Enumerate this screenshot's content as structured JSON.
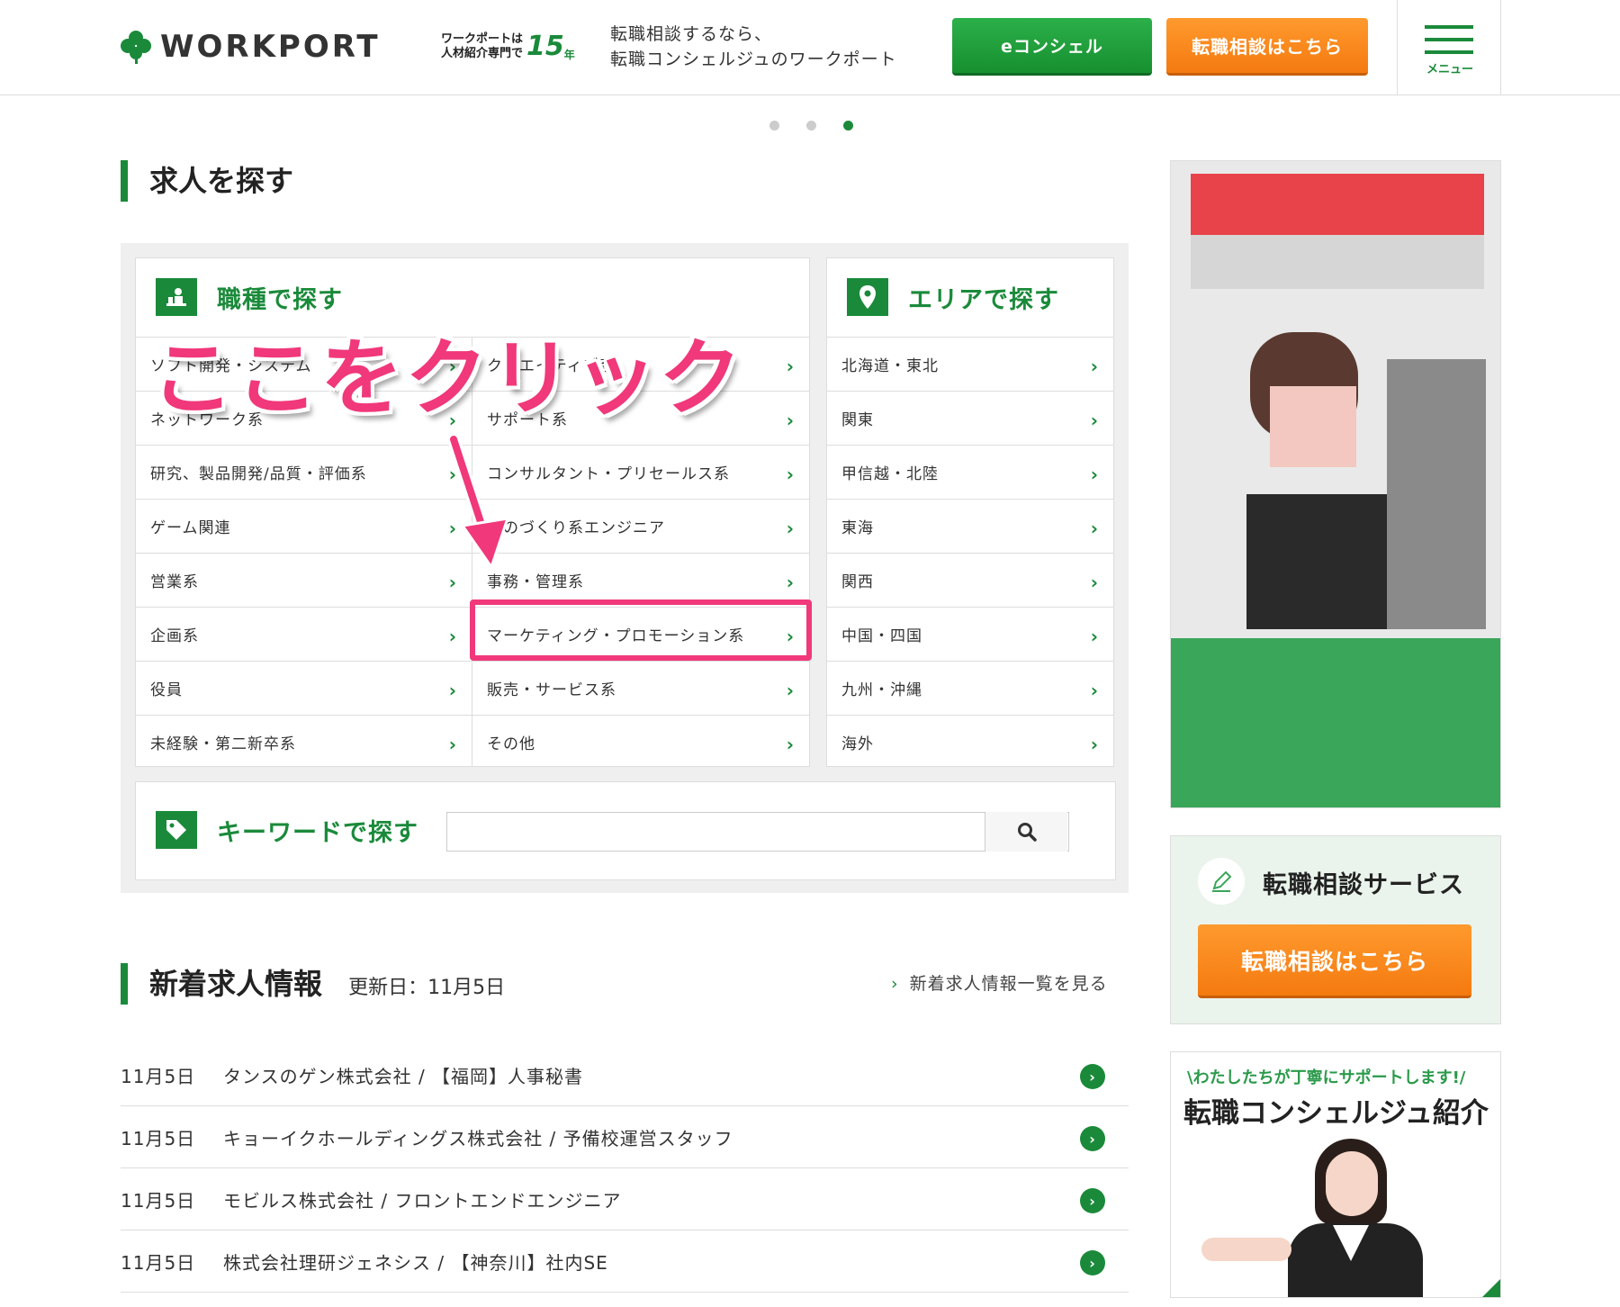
{
  "header": {
    "logo_text": "WORKPORT",
    "badge_line1": "ワークポートは",
    "badge_line2": "人材紹介専門で",
    "badge_number": "15",
    "badge_unit": "年",
    "tagline_line1": "転職相談するなら、",
    "tagline_line2": "転職コンシェルジュのワークポート",
    "econcier_label": "eコンシェル",
    "consult_label": "転職相談はこちら",
    "menu_label": "メニュー"
  },
  "carousel": {
    "active_index": 2,
    "count": 3
  },
  "search_section": {
    "title": "求人を探す",
    "job_card": {
      "title": "職種で探す",
      "left_items": [
        "ソフト開発・システム",
        "ネットワーク系",
        "研究、製品開発/品質・評価系",
        "ゲーム関連",
        "営業系",
        "企画系",
        "役員",
        "未経験・第二新卒系"
      ],
      "right_items": [
        "クリエイティブ系",
        "サポート系",
        "コンサルタント・プリセールス系",
        "ものづくり系エンジニア",
        "事務・管理系",
        "マーケティング・プロモーション系",
        "販売・サービス系",
        "その他"
      ]
    },
    "area_card": {
      "title": "エリアで探す",
      "items": [
        "北海道・東北",
        "関東",
        "甲信越・北陸",
        "東海",
        "関西",
        "中国・四国",
        "九州・沖縄",
        "海外"
      ]
    },
    "keyword": {
      "title": "キーワードで探す",
      "placeholder": ""
    }
  },
  "annotation": {
    "text": "ここをクリック"
  },
  "news": {
    "title": "新着求人情報",
    "updated": "更新日：11月5日",
    "more_link": "新着求人情報一覧を見る",
    "items": [
      {
        "date": "11月5日",
        "text": "タンスのゲン株式会社 / 【福岡】人事秘書"
      },
      {
        "date": "11月5日",
        "text": "キョーイクホールディングス株式会社 / 予備校運営スタッフ"
      },
      {
        "date": "11月5日",
        "text": "モビルス株式会社 / フロントエンドエンジニア"
      },
      {
        "date": "11月5日",
        "text": "株式会社理研ジェネシス / 【神奈川】社内SE"
      }
    ]
  },
  "sidebar": {
    "service_title": "転職相談サービス",
    "service_button": "転職相談はこちら",
    "concierge_caption": "\\わたしたちが丁寧にサポートします!/",
    "concierge_title": "転職コンシェルジュ紹介"
  },
  "colors": {
    "brand_green": "#1a8a3a",
    "accent_orange": "#f47a10",
    "highlight_pink": "#f0387a"
  }
}
